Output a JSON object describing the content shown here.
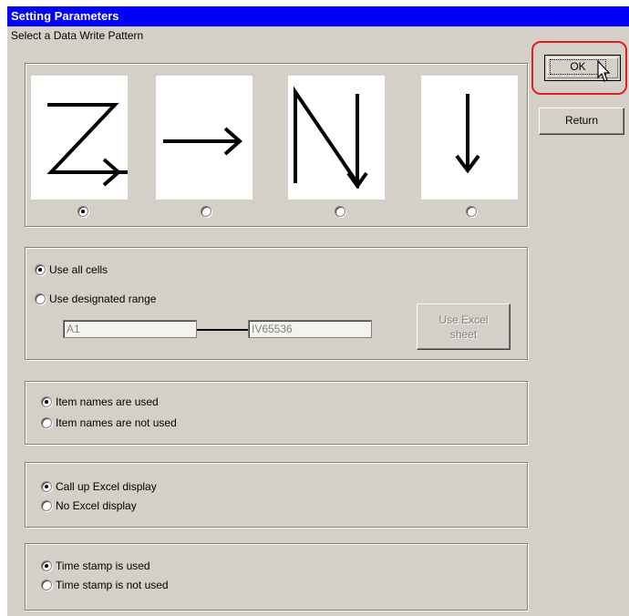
{
  "window": {
    "title": "Setting Parameters"
  },
  "pattern": {
    "label": "Select a Data Write Pattern",
    "options": [
      {
        "icon": "z-pattern-arrow-icon",
        "selected": true
      },
      {
        "icon": "right-arrow-icon",
        "selected": false
      },
      {
        "icon": "n-pattern-arrow-icon",
        "selected": false
      },
      {
        "icon": "down-arrow-icon",
        "selected": false
      }
    ]
  },
  "range": {
    "use_all": "Use all cells",
    "use_designated": "Use designated range",
    "from_value": "A1",
    "to_value": "IV65536",
    "excel_sheet_line1": "Use Excel",
    "excel_sheet_line2": "sheet"
  },
  "item_names": {
    "used": "Item names are used",
    "not_used": "Item names are not used"
  },
  "excel_display": {
    "call_up": "Call up Excel display",
    "none": "No  Excel display"
  },
  "time_stamp": {
    "used": "Time stamp is used",
    "not_used": "Time stamp is not used"
  },
  "buttons": {
    "ok": "OK",
    "return": "Return"
  },
  "colors": {
    "titlebar": "#0000ff",
    "highlight": "#e02020",
    "dialog": "#d4d0c8"
  }
}
